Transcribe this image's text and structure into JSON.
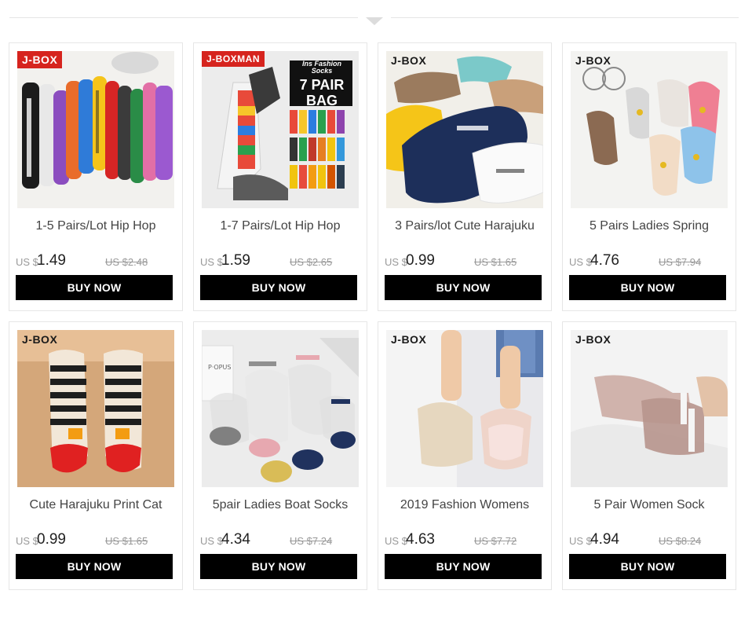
{
  "currency_label": "US $",
  "button_label": "BUY NOW",
  "products": [
    {
      "title": "1-5 Pairs/Lot Hip Hop",
      "price": "1.49",
      "old_price": "US $2.48",
      "brand": "J-BOX",
      "brand_style": "red"
    },
    {
      "title": "1-7 Pairs/Lot Hip Hop",
      "price": "1.59",
      "old_price": "US $2.65",
      "brand": "J-BOXMAN",
      "brand_style": "red",
      "overlay": {
        "line1": "Ins Fashion Socks",
        "line2": "7 PAIR",
        "line3": "BAG"
      }
    },
    {
      "title": "3 Pairs/lot Cute Harajuku",
      "price": "0.99",
      "old_price": "US $1.65",
      "brand": "J-BOX",
      "brand_style": "plain"
    },
    {
      "title": "5 Pairs Ladies Spring",
      "price": "4.76",
      "old_price": "US $7.94",
      "brand": "J-BOX",
      "brand_style": "plain"
    },
    {
      "title": "Cute Harajuku Print Cat",
      "price": "0.99",
      "old_price": "US $1.65",
      "brand": "J-BOX",
      "brand_style": "plain"
    },
    {
      "title": "5pair Ladies Boat Socks",
      "price": "4.34",
      "old_price": "US $7.24",
      "brand": "",
      "brand_style": "none"
    },
    {
      "title": "2019 Fashion Womens",
      "price": "4.63",
      "old_price": "US $7.72",
      "brand": "J-BOX",
      "brand_style": "plain"
    },
    {
      "title": "5 Pair Women Sock",
      "price": "4.94",
      "old_price": "US $8.24",
      "brand": "J-BOX",
      "brand_style": "plain"
    }
  ],
  "colors": {
    "button_bg": "#000000",
    "brand_red": "#d6241e"
  }
}
